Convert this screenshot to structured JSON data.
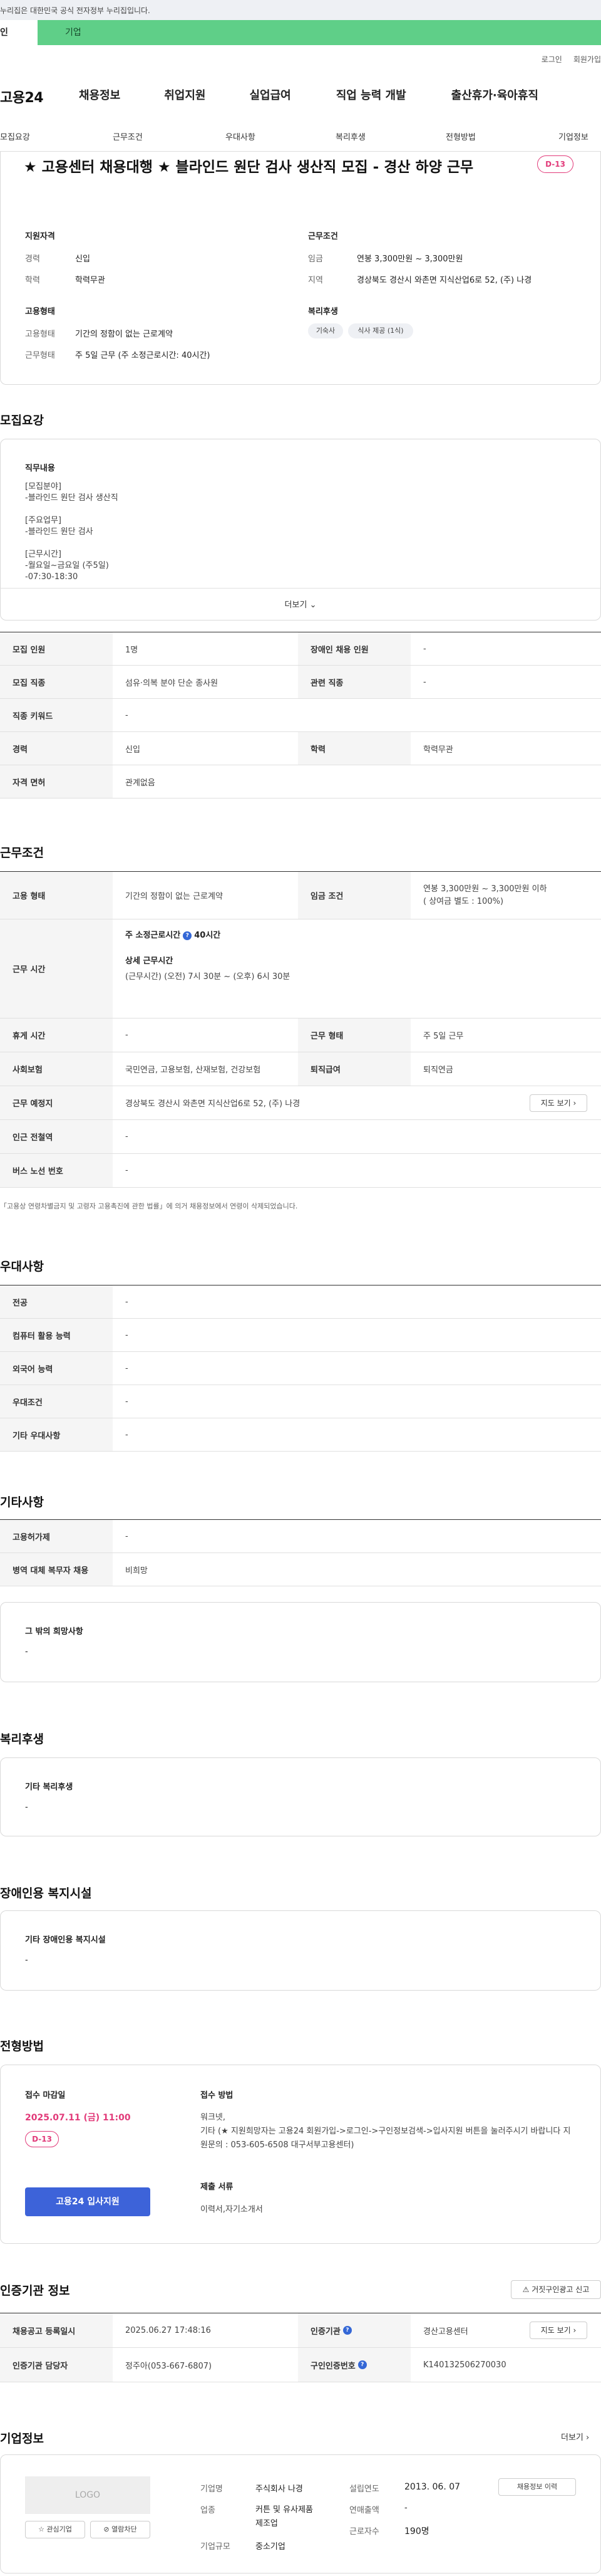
{
  "gov_notice": "누리집은 대한민국 공식 전자정부 누리집입니다.",
  "user_tabs": {
    "personal": "인",
    "company": "기업"
  },
  "util": {
    "login": "로그인",
    "join": "회원가입"
  },
  "logo": "고용24",
  "gnb": [
    "채용정보",
    "취업지원",
    "실업급여",
    "직업 능력 개발",
    "출산휴가·육아휴직"
  ],
  "subnav": [
    "모집요강",
    "근무조건",
    "우대사항",
    "복리후생",
    "전형방법",
    "기업정보"
  ],
  "summary": {
    "title": "★ 고용센터 채용대행 ★ 블라인드 원단 검사 생산직 모집 - 경산 하양 근무",
    "dday": "D-13",
    "qual_heading": "지원자격",
    "career_k": "경력",
    "career_v": "신입",
    "edu_k": "학력",
    "edu_v": "학력무관",
    "work_heading": "근무조건",
    "wage_k": "임금",
    "wage_v": "연봉 3,300만원 ~ 3,300만원",
    "region_k": "지역",
    "region_v": "경상북도 경산시 와촌면 지식산업6로 52, (주) 나경",
    "emp_heading": "고용형태",
    "emptype_k": "고용형태",
    "emptype_v": "기간의 정함이 없는 근로계약",
    "worktype_k": "근무형태",
    "worktype_v": "주 5일 근무 (주 소정근로시간: 40시간)",
    "welfare_heading": "복리후생",
    "tags": [
      "기숙사",
      "식사 제공 (1식)"
    ]
  },
  "recruit": {
    "section_title": "모집요강",
    "duty_heading": "직무내용",
    "duty_text": "[모집분야]\n-블라인드 원단 검사 생산직\n\n[주요업무]\n-블라인드 원단 검사\n\n[근무시간]\n-월요일~금요일 (주5일)\n-07:30-18:30",
    "more": "더보기",
    "rows": [
      {
        "k1": "모집 인원",
        "v1": "1명",
        "k2": "장애인 채용 인원",
        "v2": "-"
      },
      {
        "k1": "모집 직종",
        "v1": "섬유·의복 분야 단순 종사원",
        "k2": "관련 직종",
        "v2": "-"
      },
      {
        "k1": "직종 키워드",
        "v1": "-"
      },
      {
        "k1": "경력",
        "v1": "신입",
        "k2": "학력",
        "v2": "학력무관"
      },
      {
        "k1": "자격 면허",
        "v1": "관계없음"
      }
    ]
  },
  "conditions": {
    "section_title": "근무조건",
    "emp_k": "고용 형태",
    "emp_v": "기간의 정함이 없는 근로계약",
    "wage_k": "임금 조건",
    "wage_v1": "연봉 3,300만원 ~ 3,300만원 이하",
    "wage_v2": "( 상여금 별도 : 100%)",
    "hours_k": "근무 시간",
    "hours_label": "주 소정근로시간",
    "hours_value": "40시간",
    "hours_detail_label": "상세 근무시간",
    "hours_detail": "(근무시간) (오전) 7시 30분 ~ (오후) 6시 30분",
    "rest_k": "휴게 시간",
    "rest_v": "-",
    "form_k": "근무 형태",
    "form_v": "주 5일 근무",
    "ins_k": "사회보험",
    "ins_v": "국민연금, 고용보험, 산재보험, 건강보험",
    "sev_k": "퇴직급여",
    "sev_v": "퇴직연금",
    "loc_k": "근무 예정지",
    "loc_v": "경상북도 경산시 와촌면 지식산업6로 52, (주) 나경",
    "map_btn": "지도 보기",
    "subway_k": "인근 전철역",
    "subway_v": "-",
    "bus_k": "버스 노선 번호",
    "bus_v": "-",
    "note": "「고용상 연령차별금지 및 고령자 고용촉진에 관한 법률」에 의거 채용정보에서 연령이 삭제되었습니다."
  },
  "preference": {
    "section_title": "우대사항",
    "rows": [
      {
        "k": "전공",
        "v": "-"
      },
      {
        "k": "컴퓨터 활용 능력",
        "v": "-"
      },
      {
        "k": "외국어 능력",
        "v": "-"
      },
      {
        "k": "우대조건",
        "v": "-"
      },
      {
        "k": "기타 우대사항",
        "v": "-"
      }
    ]
  },
  "etc": {
    "section_title": "기타사항",
    "rows": [
      {
        "k": "고용허가제",
        "v": "-"
      },
      {
        "k": "병역 대체 복무자 채용",
        "v": "비희망"
      }
    ],
    "hope_heading": "그 밖의 희망사항",
    "hope_v": "-"
  },
  "welfare": {
    "section_title": "복리후생",
    "heading": "기타 복리후생",
    "v": "-"
  },
  "disabled": {
    "section_title": "장애인용 복지시설",
    "heading": "기타 장애인용 복지시설",
    "v": "-"
  },
  "screening": {
    "section_title": "전형방법",
    "deadline_heading": "접수 마감일",
    "deadline": "2025.07.11 (금) 11:00",
    "dday": "D-13",
    "apply_btn": "고용24 입사지원",
    "method_heading": "접수 방법",
    "method_text": "워크넷,\n기타 (★ 지원희망자는 고용24 회원가입->로그인->구인정보검색->입사지원 버튼을 눌러주시기 바랍니다     지원문의 : 053-605-6508 대구서부고용센터)",
    "docs_heading": "제출 서류",
    "docs_text": "이력서,자기소개서"
  },
  "agency": {
    "section_title": "인증기관 정보",
    "report_btn": "거짓구인광고 신고",
    "reg_k": "채용공고 등록일시",
    "reg_v": "2025.06.27 17:48:16",
    "org_k": "인증기관",
    "org_v": "경산고용센터",
    "map_btn": "지도 보기",
    "staff_k": "인증기관 담당자",
    "staff_v": "정주아(053-667-6807)",
    "no_k": "구인인증번호",
    "no_v": "K140132506270030"
  },
  "company": {
    "section_title": "기업정보",
    "more": "더보기",
    "logo": "LOGO",
    "fav_btn": "관심기업",
    "block_btn": "열람차단",
    "name_k": "기업명",
    "name_v": "주식회사 나경",
    "ind_k": "업종",
    "ind_v": "커튼 및 유사제품\n제조업",
    "size_k": "기업규모",
    "size_v": "중소기업",
    "est_k": "설립연도",
    "est_v": "2013. 06. 07",
    "rev_k": "연매출액",
    "rev_v": "-",
    "emp_k": "근로자수",
    "emp_v": "190명",
    "jobs_btn": "채용정보 이력"
  }
}
